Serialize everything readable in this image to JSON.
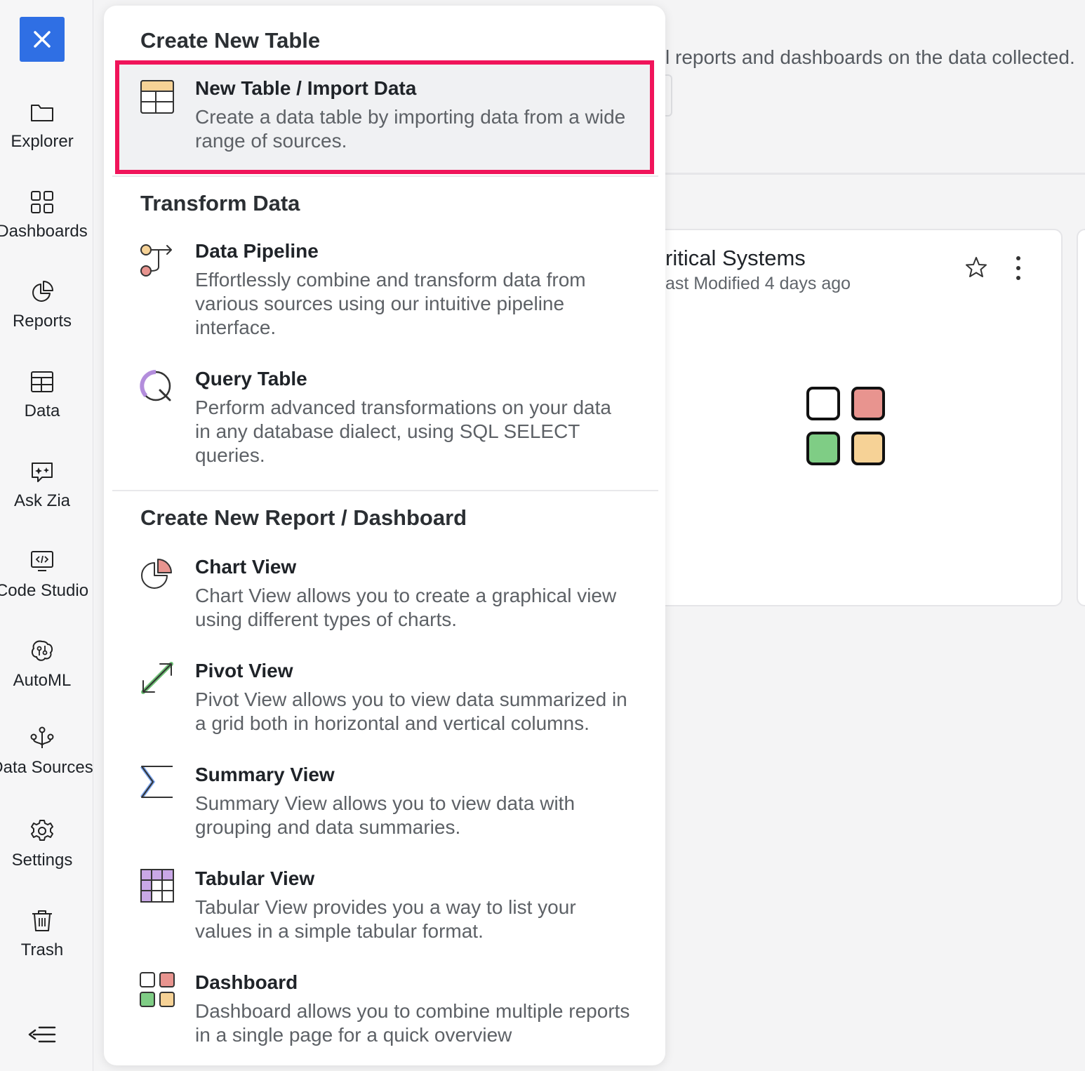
{
  "sidebar": {
    "items": [
      {
        "label": "Explorer",
        "icon": "folder-icon"
      },
      {
        "label": "Dashboards",
        "icon": "grid-icon"
      },
      {
        "label": "Reports",
        "icon": "pie-chart-icon"
      },
      {
        "label": "Data",
        "icon": "table-icon"
      },
      {
        "label": "Ask Zia",
        "icon": "chat-sparkle-icon"
      },
      {
        "label": "Code Studio",
        "icon": "code-icon"
      },
      {
        "label": "AutoML",
        "icon": "brain-icon"
      },
      {
        "label": "Data Sources",
        "icon": "data-sources-icon"
      },
      {
        "label": "Settings",
        "icon": "gear-icon"
      },
      {
        "label": "Trash",
        "icon": "trash-icon"
      }
    ]
  },
  "background": {
    "top_text": "l reports and dashboards on the data collected.",
    "card": {
      "title": "ritical Systems",
      "subtitle": "ast Modified 4 days ago"
    }
  },
  "popup": {
    "sections": [
      {
        "title": "Create New Table"
      },
      {
        "title": "Transform Data"
      },
      {
        "title": "Create New Report / Dashboard"
      }
    ],
    "items": [
      {
        "title": "New Table / Import Data",
        "desc": "Create a data table by importing data from a wide range of sources."
      },
      {
        "title": "Data Pipeline",
        "desc": "Effortlessly combine and transform data from various sources using our intuitive pipeline interface."
      },
      {
        "title": "Query Table",
        "desc": "Perform advanced transformations on your data in any database dialect, using SQL SELECT queries."
      },
      {
        "title": "Chart View",
        "desc": "Chart View allows you to create a graphical view using different types of charts."
      },
      {
        "title": "Pivot View",
        "desc": "Pivot View allows you to view data summarized in a grid both in horizontal and vertical columns."
      },
      {
        "title": "Summary View",
        "desc": "Summary View allows you to view data with grouping and data summaries."
      },
      {
        "title": "Tabular View",
        "desc": "Tabular View provides you a way to list your values in a simple tabular format."
      },
      {
        "title": "Dashboard",
        "desc": "Dashboard allows you to combine multiple reports in a single page for a quick overview"
      }
    ]
  },
  "colors": {
    "accent_blue": "#2f6fe4",
    "highlight_border": "#f0145a",
    "dash_red": "#e8948f",
    "dash_green": "#7fcd85",
    "dash_yellow": "#f6d296"
  }
}
